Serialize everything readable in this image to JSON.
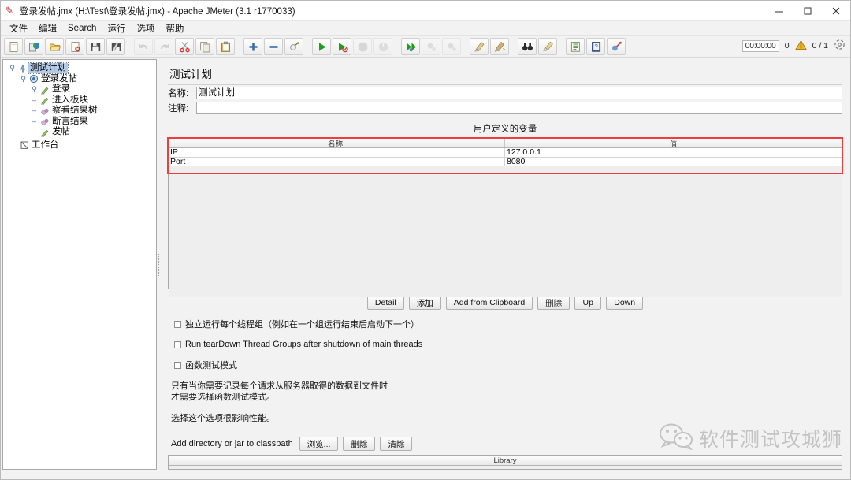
{
  "window": {
    "title": "登录发帖.jmx (H:\\Test\\登录发帖.jmx) - Apache JMeter (3.1 r1770033)",
    "app_icon": "jmeter-feather-icon",
    "minimize": "minimize-icon",
    "maximize": "maximize-icon",
    "close": "close-icon"
  },
  "menubar": {
    "items": [
      {
        "label": "文件"
      },
      {
        "label": "编辑"
      },
      {
        "label": "Search"
      },
      {
        "label": "运行"
      },
      {
        "label": "选项"
      },
      {
        "label": "帮助"
      }
    ]
  },
  "toolbar": {
    "groups": [
      {
        "buttons": [
          {
            "icon": "new-file-icon",
            "enabled": true
          },
          {
            "icon": "templates-icon",
            "enabled": true
          },
          {
            "icon": "open-folder-icon",
            "enabled": true
          },
          {
            "icon": "close-test-plan-icon",
            "enabled": true
          },
          {
            "icon": "save-icon",
            "enabled": true
          },
          {
            "icon": "save-as-icon",
            "enabled": true
          }
        ]
      },
      {
        "buttons": [
          {
            "icon": "undo-icon",
            "enabled": false
          },
          {
            "icon": "redo-icon",
            "enabled": false
          },
          {
            "icon": "cut-scissors-icon",
            "enabled": true
          },
          {
            "icon": "copy-icon",
            "enabled": true
          },
          {
            "icon": "paste-clipboard-icon",
            "enabled": true
          }
        ]
      },
      {
        "buttons": [
          {
            "icon": "expand-all-plus-icon",
            "enabled": true
          },
          {
            "icon": "collapse-all-minus-icon",
            "enabled": true
          },
          {
            "icon": "toggle-node-icon",
            "enabled": true
          }
        ]
      },
      {
        "buttons": [
          {
            "icon": "start-play-icon",
            "enabled": true
          },
          {
            "icon": "start-no-pauses-icon",
            "enabled": true
          },
          {
            "icon": "stop-icon",
            "enabled": false
          },
          {
            "icon": "shutdown-icon",
            "enabled": false
          }
        ]
      },
      {
        "buttons": [
          {
            "icon": "remote-start-all-icon",
            "enabled": true
          },
          {
            "icon": "remote-stop-all-icon",
            "enabled": false
          },
          {
            "icon": "remote-shutdown-all-icon",
            "enabled": false
          }
        ]
      },
      {
        "buttons": [
          {
            "icon": "clear-icon",
            "enabled": true
          },
          {
            "icon": "clear-all-icon",
            "enabled": true
          }
        ]
      },
      {
        "buttons": [
          {
            "icon": "search-binoculars-icon",
            "enabled": true
          },
          {
            "icon": "search-reset-brush-icon",
            "enabled": true
          }
        ]
      },
      {
        "buttons": [
          {
            "icon": "function-helper-icon",
            "enabled": true
          },
          {
            "icon": "help-book-icon",
            "enabled": true
          },
          {
            "icon": "ssl-manager-icon",
            "enabled": true
          }
        ]
      }
    ],
    "status": {
      "elapsed": "00:00:00",
      "error_count": "0",
      "warning_icon": "warning-triangle-icon",
      "threads_ratio": "0 / 1",
      "connect_icon": "active-threads-icon"
    }
  },
  "tree": {
    "nodes": [
      {
        "label": "测试计划",
        "icon": "test-plan-icon",
        "depth": 0,
        "handle": "expanded",
        "selected": true
      },
      {
        "label": "登录发帖",
        "icon": "thread-group-icon",
        "depth": 1,
        "handle": "expanded",
        "selected": false
      },
      {
        "label": "登录",
        "icon": "http-request-icon",
        "depth": 2,
        "handle": "expanded",
        "selected": false
      },
      {
        "label": "进入板块",
        "icon": "http-request-icon",
        "depth": 2,
        "handle": "leaf",
        "selected": false
      },
      {
        "label": "察看结果树",
        "icon": "view-results-tree-icon",
        "depth": 2,
        "handle": "leaf",
        "selected": false
      },
      {
        "label": "断言结果",
        "icon": "assertion-results-icon",
        "depth": 2,
        "handle": "leaf",
        "selected": false
      },
      {
        "label": "发帖",
        "icon": "http-request-icon",
        "depth": 2,
        "handle": "leaf",
        "selected": false
      },
      {
        "label": "工作台",
        "icon": "workbench-icon",
        "depth": 0,
        "handle": "leaf",
        "selected": false
      }
    ]
  },
  "main": {
    "panel_title": "测试计划",
    "name_label": "名称:",
    "name_value": "测试计划",
    "comment_label": "注释:",
    "comment_value": "",
    "variables": {
      "section_title": "用户定义的变量",
      "columns": [
        "名称:",
        "值"
      ],
      "rows": [
        {
          "name": "IP",
          "value": "127.0.0.1"
        },
        {
          "name": "Port",
          "value": "8080"
        }
      ],
      "highlighted": true,
      "highlight_color": "#f23b3b"
    },
    "table_buttons": [
      {
        "label": "Detail"
      },
      {
        "label": "添加"
      },
      {
        "label": "Add from Clipboard"
      },
      {
        "label": "删除"
      },
      {
        "label": "Up"
      },
      {
        "label": "Down"
      }
    ],
    "checkboxes": [
      {
        "label": "独立运行每个线程组（例如在一个组运行结束后启动下一个）",
        "checked": false
      },
      {
        "label": "Run tearDown Thread Groups after shutdown of main threads",
        "checked": false
      },
      {
        "label": "函数测试模式",
        "checked": false
      }
    ],
    "help_lines": [
      "只有当你需要记录每个请求从服务器取得的数据到文件时",
      "才需要选择函数测试模式。"
    ],
    "help_note": "选择这个选项很影响性能。",
    "classpath": {
      "label": "Add directory or jar to classpath",
      "buttons": [
        {
          "label": "浏览..."
        },
        {
          "label": "删除"
        },
        {
          "label": "清除"
        }
      ],
      "table_header": "Library",
      "rows": []
    }
  },
  "watermark": {
    "icon": "wechat-logo-icon",
    "text": "软件测试攻城狮"
  }
}
